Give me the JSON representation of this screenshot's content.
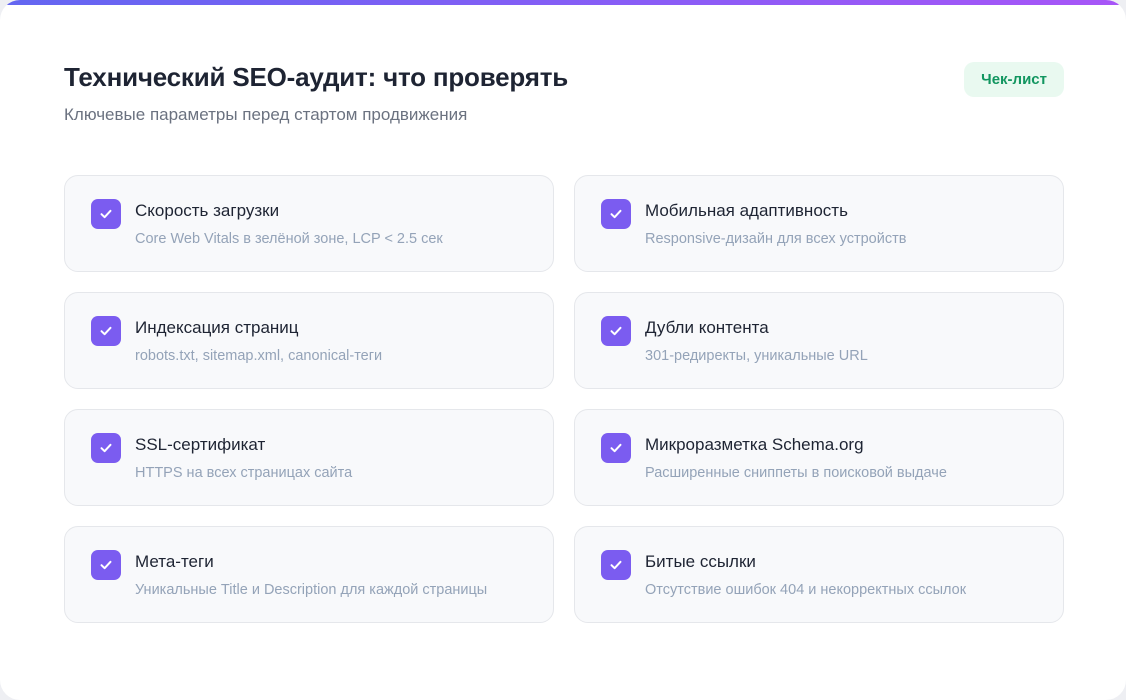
{
  "header": {
    "title": "Технический SEO-аудит: что проверять",
    "subtitle": "Ключевые параметры перед стартом продвижения",
    "badge": "Чек-лист"
  },
  "colors": {
    "accent": "#7b5cf0",
    "badge_bg": "#e9f9f0",
    "badge_text": "#129660"
  },
  "items": [
    {
      "title": "Скорость загрузки",
      "desc": "Core Web Vitals в зелёной зоне, LCP < 2.5 сек",
      "icon": "check-icon",
      "checked": true
    },
    {
      "title": "Мобильная адаптивность",
      "desc": "Responsive-дизайн для всех устройств",
      "icon": "check-icon",
      "checked": true
    },
    {
      "title": "Индексация страниц",
      "desc": "robots.txt, sitemap.xml, canonical-теги",
      "icon": "check-icon",
      "checked": true
    },
    {
      "title": "Дубли контента",
      "desc": "301-редиректы, уникальные URL",
      "icon": "check-icon",
      "checked": true
    },
    {
      "title": "SSL-сертификат",
      "desc": "HTTPS на всех страницах сайта",
      "icon": "check-icon",
      "checked": true
    },
    {
      "title": "Микроразметка Schema.org",
      "desc": "Расширенные сниппеты в поисковой выдаче",
      "icon": "check-icon",
      "checked": true
    },
    {
      "title": "Мета-теги",
      "desc": "Уникальные Title и Description для каждой страницы",
      "icon": "check-icon",
      "checked": true
    },
    {
      "title": "Битые ссылки",
      "desc": "Отсутствие ошибок 404 и некорректных ссылок",
      "icon": "check-icon",
      "checked": true
    }
  ]
}
